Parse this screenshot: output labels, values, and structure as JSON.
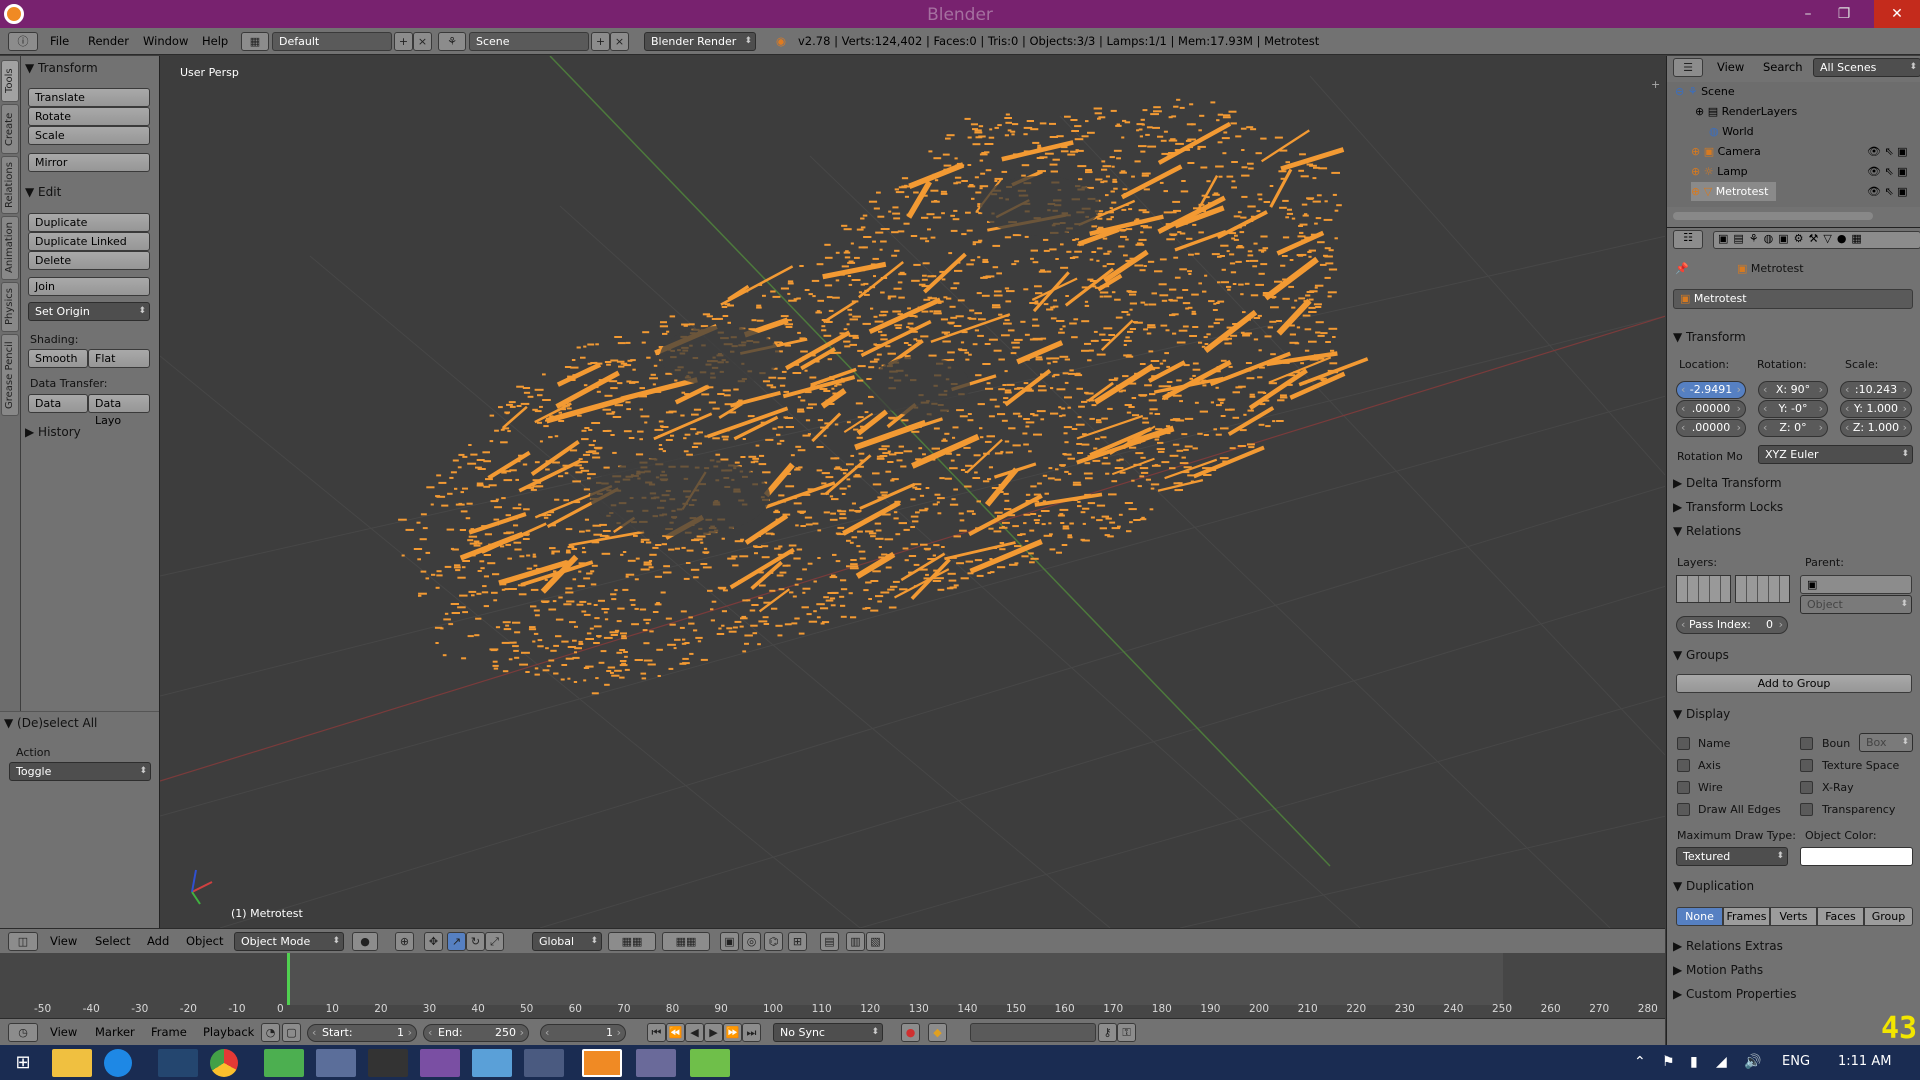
{
  "window": {
    "title": "Blender",
    "min": "–",
    "max": "❐",
    "close": "✕"
  },
  "menubar": {
    "items": [
      "File",
      "Render",
      "Window",
      "Help"
    ],
    "layout": "Default",
    "scene": "Scene",
    "engine": "Blender Render",
    "stats": "v2.78 | Verts:124,402 | Faces:0 | Tris:0 | Objects:3/3 | Lamps:1/1 | Mem:17.93M | Metrotest"
  },
  "tooltabs": [
    "Tools",
    "Create",
    "Relations",
    "Animation",
    "Physics",
    "Grease Pencil"
  ],
  "toolshelf": {
    "transform": {
      "title": "Transform",
      "buttons": [
        "Translate",
        "Rotate",
        "Scale",
        "Mirror"
      ]
    },
    "edit": {
      "title": "Edit",
      "buttons": [
        "Duplicate",
        "Duplicate Linked",
        "Delete",
        "Join"
      ],
      "set_origin": "Set Origin",
      "shading_label": "Shading:",
      "smooth": "Smooth",
      "flat": "Flat",
      "data_transfer_label": "Data Transfer:",
      "data": "Data",
      "data_layo": "Data Layo"
    },
    "history": "History"
  },
  "operator": {
    "title": "(De)select All",
    "action_label": "Action",
    "action_value": "Toggle"
  },
  "viewport": {
    "view_name": "User Persp",
    "object_label": "(1) Metrotest"
  },
  "viewheader": {
    "menus": [
      "View",
      "Select",
      "Add",
      "Object"
    ],
    "mode": "Object Mode",
    "orientation": "Global"
  },
  "timeline": {
    "ticks": [
      "-50",
      "-40",
      "-30",
      "-20",
      "-10",
      "0",
      "10",
      "20",
      "30",
      "40",
      "50",
      "60",
      "70",
      "80",
      "90",
      "100",
      "110",
      "120",
      "130",
      "140",
      "150",
      "160",
      "170",
      "180",
      "190",
      "200",
      "210",
      "220",
      "230",
      "240",
      "250",
      "260",
      "270",
      "280"
    ],
    "current_frame_position": 0
  },
  "tlheader": {
    "menus": [
      "View",
      "Marker",
      "Frame",
      "Playback"
    ],
    "start_label": "Start:",
    "start": "1",
    "end_label": "End:",
    "end": "250",
    "current": "1",
    "sync": "No Sync"
  },
  "outliner": {
    "menus": [
      "View",
      "Search"
    ],
    "filter": "All Scenes",
    "rows": [
      "Scene",
      "RenderLayers",
      "World",
      "Camera",
      "Lamp",
      "Metrotest"
    ]
  },
  "properties": {
    "breadcrumb": "Metrotest",
    "name": "Metrotest",
    "transform": {
      "title": "Transform",
      "location_label": "Location:",
      "rotation_label": "Rotation:",
      "scale_label": "Scale:",
      "location": [
        "-2.9491",
        ".00000",
        ".00000"
      ],
      "rotation": [
        "X:   90°",
        "Y:    -0°",
        "Z:     0°"
      ],
      "scale": [
        ":10.243",
        "Y: 1.000",
        "Z: 1.000"
      ],
      "rotmode_label": "Rotation Mo",
      "rotmode": "XYZ Euler"
    },
    "collapsed1": [
      "Delta Transform",
      "Transform Locks"
    ],
    "relations": {
      "title": "Relations",
      "layers_label": "Layers:",
      "parent_label": "Parent:",
      "parent_type": "Object",
      "pass_index": "Pass Index:",
      "pass_value": "0"
    },
    "groups": {
      "title": "Groups",
      "add": "Add to Group"
    },
    "display": {
      "title": "Display",
      "left": [
        "Name",
        "Axis",
        "Wire",
        "Draw All Edges"
      ],
      "right": [
        "Boun",
        "Texture Space",
        "X-Ray",
        "Transparency"
      ],
      "bounds_type": "Box",
      "maxdraw_label": "Maximum Draw Type:",
      "maxdraw": "Textured",
      "objcolor_label": "Object Color:"
    },
    "duplication": {
      "title": "Duplication",
      "options": [
        "None",
        "Frames",
        "Verts",
        "Faces",
        "Group"
      ],
      "active": "None"
    },
    "collapsed2": [
      "Relations Extras",
      "Motion Paths",
      "Custom Properties"
    ]
  },
  "overlay_number": "43",
  "taskbar": {
    "lang": "ENG",
    "time": "1:11 AM"
  },
  "colors": {
    "points": "#f39a33",
    "titlebar": "#78226f",
    "accent": "#5680c2",
    "taskbar": "#1a2c52"
  }
}
